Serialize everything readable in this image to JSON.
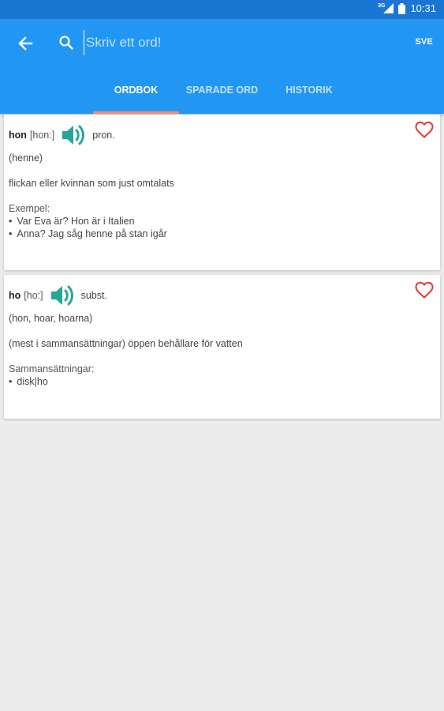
{
  "status_bar": {
    "network": "3G",
    "time": "10:31"
  },
  "toolbar": {
    "search_placeholder": "Skriv ett ord!",
    "language": "SVE"
  },
  "tabs": [
    {
      "label": "ORDBOK",
      "active": true
    },
    {
      "label": "SPARADE ORD",
      "active": false
    },
    {
      "label": "HISTORIK",
      "active": false
    }
  ],
  "colors": {
    "status_bar": "#1976d2",
    "app_bar": "#2196f3",
    "tab_indicator": "#ff8a65",
    "speaker": "#26a69a",
    "heart": "#e53935",
    "background": "#ececec"
  },
  "entries": [
    {
      "word": "hon",
      "pronunciation": "[hon:]",
      "part_of_speech": "pron.",
      "inflection": "(henne)",
      "definition": "flickan eller kvinnan som just omtalats",
      "section_label": "Exempel:",
      "items": [
        "Var Eva är? Hon är i Italien",
        "Anna? Jag såg henne på stan igår"
      ]
    },
    {
      "word": "ho",
      "pronunciation": "[ho:]",
      "part_of_speech": "subst.",
      "inflection": "(hon, hoar, hoarna)",
      "definition": "(mest i sammansättningar) öppen behållare för vatten",
      "section_label": "Sammansättningar:",
      "items": [
        "disk|ho"
      ]
    }
  ]
}
